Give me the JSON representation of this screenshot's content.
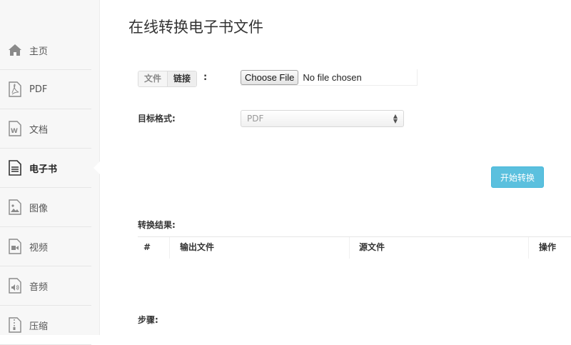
{
  "sidebar": {
    "items": [
      {
        "label": "主页",
        "icon": "home-icon"
      },
      {
        "label": "PDF",
        "icon": "pdf-file-icon"
      },
      {
        "label": "文档",
        "icon": "word-file-icon"
      },
      {
        "label": "电子书",
        "icon": "ebook-file-icon",
        "active": true
      },
      {
        "label": "图像",
        "icon": "image-file-icon"
      },
      {
        "label": "视频",
        "icon": "video-file-icon"
      },
      {
        "label": "音频",
        "icon": "audio-file-icon"
      },
      {
        "label": "压缩",
        "icon": "zip-file-icon"
      }
    ]
  },
  "main": {
    "title": "在线转换电子书文件",
    "source_tabs": [
      "文件",
      "链接"
    ],
    "source_colon": ":",
    "file_input": {
      "button_label": "Choose File",
      "status": "No file chosen"
    },
    "target_format_label": "目标格式:",
    "target_format_value": "PDF",
    "start_button": "开始转换",
    "results_label": "转换结果:",
    "results_table": {
      "columns": [
        "#",
        "输出文件",
        "源文件",
        "操作"
      ]
    },
    "steps_label": "步骤:"
  },
  "colors": {
    "accent": "#5bc0de",
    "sidebar_bg": "#f7f7f7"
  }
}
